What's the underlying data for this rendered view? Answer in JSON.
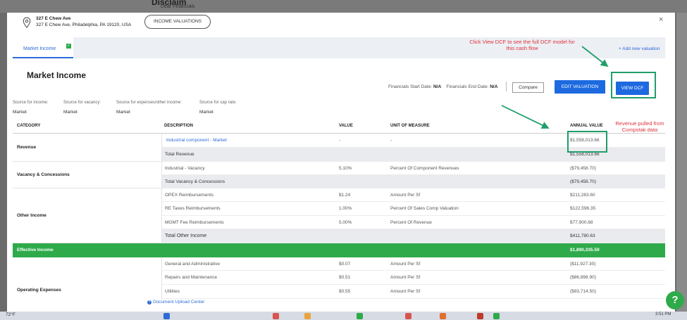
{
  "background": {
    "title": "Disclaim",
    "subtitle": "Dear Financials"
  },
  "header": {
    "address_line1": "327 E Chew Ave",
    "address_line2": "327 E Chew Ave, Philadelphia, PA 19120, USA",
    "income_valuations_btn": "INCOME VALUATIONS",
    "close": "×"
  },
  "tabs": {
    "market_income": "Market Income",
    "add_valuation": "+ Add new valuation"
  },
  "annotations": {
    "view_dcf_note": "Click View DCF to see the full DCF model for this cash flow",
    "revenue_note": "Revenue pulled from Compstak data"
  },
  "main": {
    "title": "Market Income",
    "start_label": "Financials Start Date:",
    "start_value": "N/A",
    "end_label": "Financials End Date:",
    "end_value": "N/A",
    "compare_btn": "Compare",
    "edit_btn": "EDIT VALUATION",
    "view_btn": "VIEW DCF"
  },
  "sources": [
    {
      "label": "Source for income:",
      "value": "Market"
    },
    {
      "label": "Source for vacancy:",
      "value": "Market"
    },
    {
      "label": "Source for expenses/other income:",
      "value": "Market"
    },
    {
      "label": "Source for cap rate:",
      "value": "Market"
    }
  ],
  "table": {
    "headers": [
      "CATEGORY",
      "DESCRIPTION",
      "VALUE",
      "UNIT OF MEASURE",
      "ANNUAL VALUE"
    ],
    "categories": [
      "Revenue",
      "Vacancy & Concessions",
      "Other Income",
      "Effective Income",
      "Operating Expenses"
    ],
    "rows": [
      {
        "desc": "Industrial component - Market",
        "value": "-",
        "unit": "-",
        "annual": "$1,558,013.66"
      },
      {
        "desc": "Total Revenue",
        "value": "",
        "unit": "",
        "annual": "$1,558,013.66"
      },
      {
        "desc": "Industrial - Vacancy",
        "value": "5.10%",
        "unit": "Percent Of Component Revenues",
        "annual": "($79,458.70)"
      },
      {
        "desc": "Total Vacancy & Concessions",
        "value": "",
        "unit": "",
        "annual": "($79,458.70)"
      },
      {
        "desc": "OPEX Reimbursements",
        "value": "$1.24",
        "unit": "Amount Per Sf",
        "annual": "$211,283.60"
      },
      {
        "desc": "RE Taxes Reimbursements",
        "value": "1.00%",
        "unit": "Percent Of Sales Comp Valuation",
        "annual": "$122,596.35"
      },
      {
        "desc": "MGMT Fee Reimbursements",
        "value": "5.00%",
        "unit": "Percent Of Revenue",
        "annual": "$77,900.68"
      },
      {
        "desc": "Total Other Income",
        "value": "",
        "unit": "",
        "annual": "$411,780.63"
      },
      {
        "desc": "",
        "value": "",
        "unit": "",
        "annual": "$1,890,335.59"
      },
      {
        "desc": "General and Administrative",
        "value": "$0.07",
        "unit": "Amount Per Sf",
        "annual": "($11,927.30)"
      },
      {
        "desc": "Repairs and Maintenance",
        "value": "$0.51",
        "unit": "Amount Per Sf",
        "annual": "($86,898.90)"
      },
      {
        "desc": "Utilities",
        "value": "$0.55",
        "unit": "Amount Per Sf",
        "annual": "($93,714.50)"
      }
    ]
  },
  "footer": {
    "doc_center": "Document Upload Center",
    "help": "?"
  },
  "taskbar": {
    "weather": "72°F",
    "time": "3:51 PM"
  },
  "colors": {
    "accent": "#1d6ae0",
    "green": "#2eaa4a",
    "highlight": "#1f9e6a",
    "annotation": "#e0303a"
  }
}
